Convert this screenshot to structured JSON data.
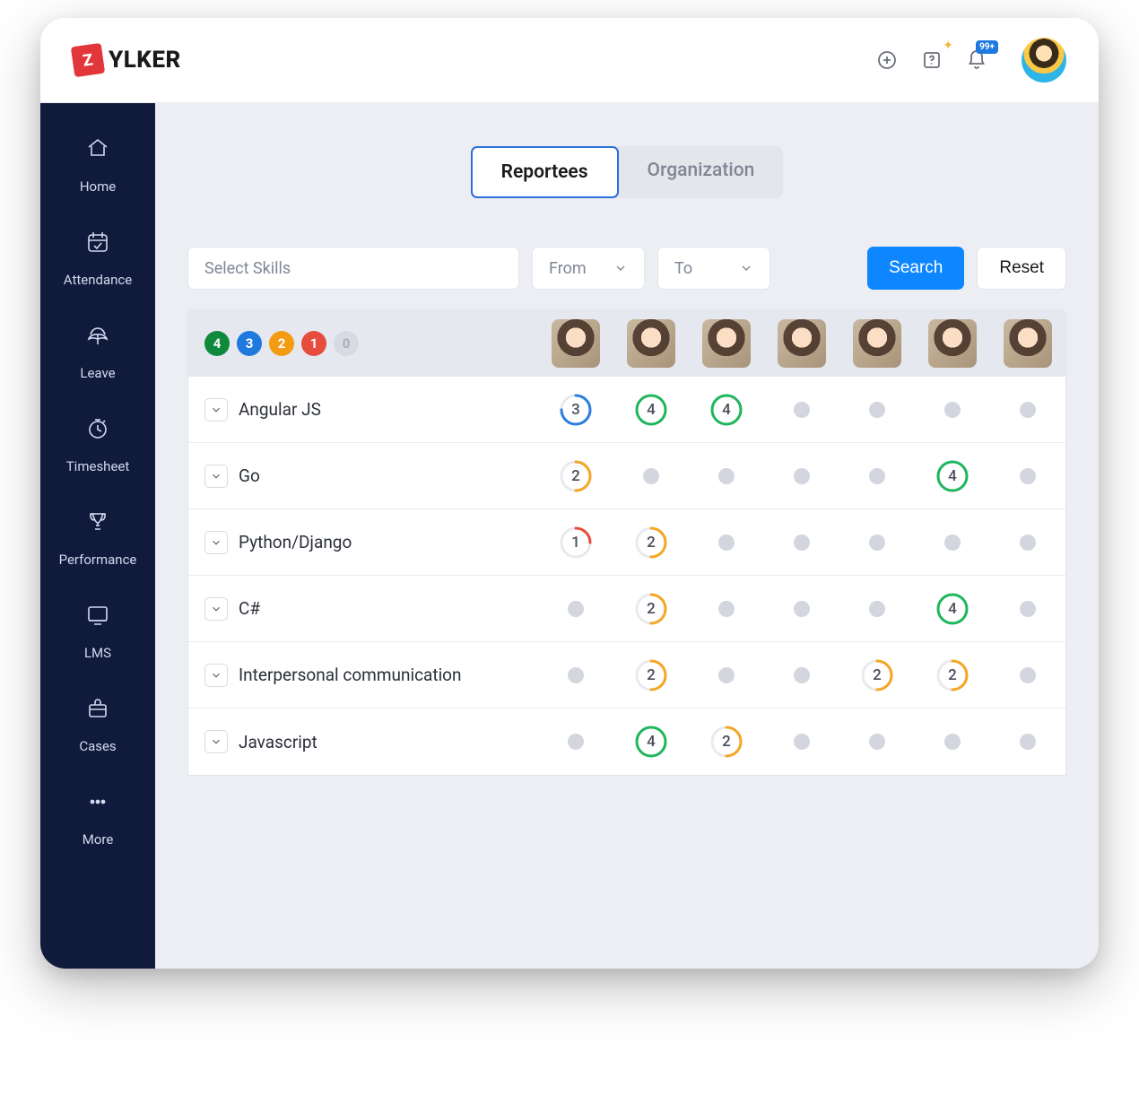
{
  "brand": {
    "mark": "Z",
    "name": "YLKER"
  },
  "header": {
    "notification_badge": "99+"
  },
  "sidebar": {
    "items": [
      {
        "id": "home",
        "label": "Home"
      },
      {
        "id": "attendance",
        "label": "Attendance"
      },
      {
        "id": "leave",
        "label": "Leave"
      },
      {
        "id": "timesheet",
        "label": "Timesheet"
      },
      {
        "id": "performance",
        "label": "Performance"
      },
      {
        "id": "lms",
        "label": "LMS"
      },
      {
        "id": "cases",
        "label": "Cases"
      },
      {
        "id": "more",
        "label": "More"
      }
    ]
  },
  "tabs": {
    "reportees": "Reportees",
    "organization": "Organization",
    "active": "reportees"
  },
  "filters": {
    "skills_placeholder": "Select Skills",
    "from_label": "From",
    "to_label": "To",
    "search_label": "Search",
    "reset_label": "Reset"
  },
  "legend": {
    "l4": "4",
    "l3": "3",
    "l2": "2",
    "l1": "1",
    "l0": "0"
  },
  "colors": {
    "score4": "#1fb65c",
    "score3": "#2a7de1",
    "score2": "#f5a623",
    "score1": "#e74c3c"
  },
  "people_count": 7,
  "skills": [
    {
      "name": "Angular JS",
      "scores": [
        3,
        4,
        4,
        null,
        null,
        null,
        null
      ]
    },
    {
      "name": "Go",
      "scores": [
        2,
        null,
        null,
        null,
        null,
        4,
        null
      ]
    },
    {
      "name": "Python/Django",
      "scores": [
        1,
        2,
        null,
        null,
        null,
        null,
        null
      ]
    },
    {
      "name": "C#",
      "scores": [
        null,
        2,
        null,
        null,
        null,
        4,
        null
      ]
    },
    {
      "name": "Interpersonal communication",
      "scores": [
        null,
        2,
        null,
        null,
        2,
        2,
        null
      ]
    },
    {
      "name": "Javascript",
      "scores": [
        null,
        4,
        2,
        null,
        null,
        null,
        null
      ]
    }
  ]
}
